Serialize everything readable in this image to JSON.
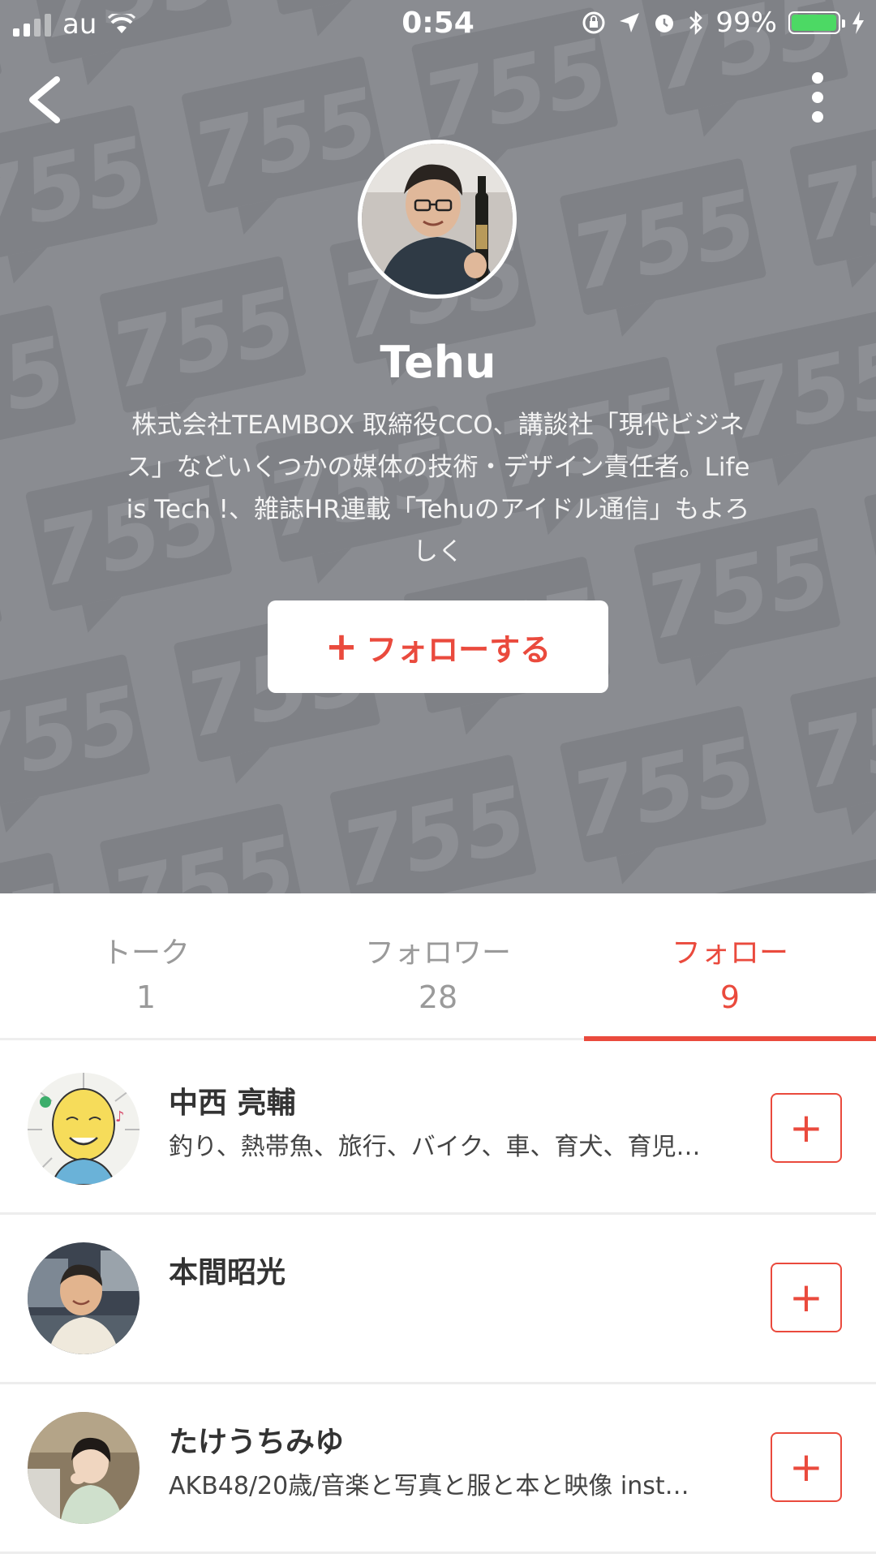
{
  "status_bar": {
    "carrier": "au",
    "time": "0:54",
    "battery": "99%",
    "battery_level": 0.99,
    "icons": [
      "signal-icon",
      "wifi-icon",
      "rotation-lock-icon",
      "location-icon",
      "alarm-icon",
      "bluetooth-icon",
      "battery-icon",
      "charging-icon"
    ]
  },
  "header": {
    "back_icon": "chevron-left-icon",
    "more_icon": "more-vertical-icon",
    "background_watermark": "755",
    "background_color": "#8a8c91"
  },
  "profile": {
    "name": "Tehu",
    "bio_lines": [
      "株式会社TEAMBOX 取締役CCO、講談社「現代ビジネ",
      "ス」などいくつかの媒体の技術・デザイン責任者。Life",
      "is Tech !、雑誌HR連載「Tehuのアイドル通信」もよろ",
      "しく"
    ],
    "follow_button": {
      "plus": "+",
      "label": "フォローする"
    }
  },
  "tabs": [
    {
      "label": "トーク",
      "count": "1"
    },
    {
      "label": "フォロワー",
      "count": "28"
    },
    {
      "label": "フォロー",
      "count": "9"
    }
  ],
  "active_tab": 2,
  "accent_color": "#ea4a3d",
  "follow_list": [
    {
      "name": "中西 亮輔",
      "description": "釣り、熱帯魚、旅行、バイク、車、育犬、育児…",
      "add_label": "+"
    },
    {
      "name": "本間昭光",
      "description": "",
      "add_label": "+"
    },
    {
      "name": "たけうちみゆ",
      "description": "AKB48/20歳/音楽と写真と服と本と映像 inst…",
      "add_label": "+"
    }
  ]
}
